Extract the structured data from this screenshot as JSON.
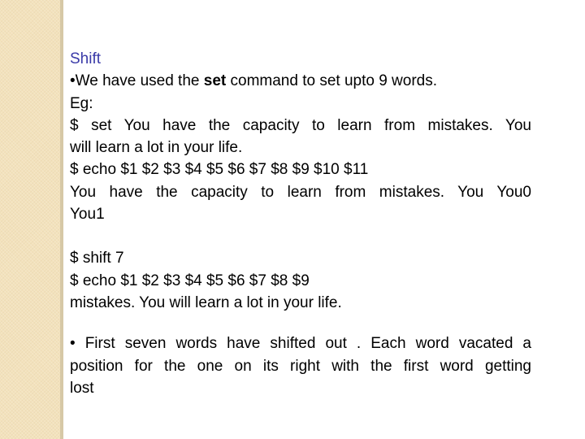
{
  "slide": {
    "title": "Shift",
    "bullet1": {
      "bullet": "•",
      "pre": "We have used the ",
      "bold": "set",
      "post": " command to set upto 9 words."
    },
    "eg_label": "Eg:",
    "set_cmd_line1": "$ set You have the capacity to learn from mistakes. You",
    "set_cmd_line2": "will learn a lot in your life.",
    "echo_cmd1": "$ echo $1 $2 $3 $4 $5 $6 $7 $8 $9 $10 $11",
    "echo_out1_line1": "You have the capacity to learn from mistakes. You You0",
    "echo_out1_line2": "You1",
    "shift_cmd": "$ shift 7",
    "echo_cmd2": "$ echo $1 $2 $3 $4 $5 $6 $7 $8 $9",
    "echo_out2": "mistakes. You will learn a lot in your life.",
    "bullet2": {
      "bullet": "•",
      "line1": "  First seven words have shifted out . Each word vacated a",
      "line2": "position for the one on its right  with the first word getting",
      "line3": "lost"
    }
  },
  "colors": {
    "title": "#3a3aa8",
    "sidebar": "#f3e2bc",
    "sidebar_edge": "#d6c8a6"
  }
}
